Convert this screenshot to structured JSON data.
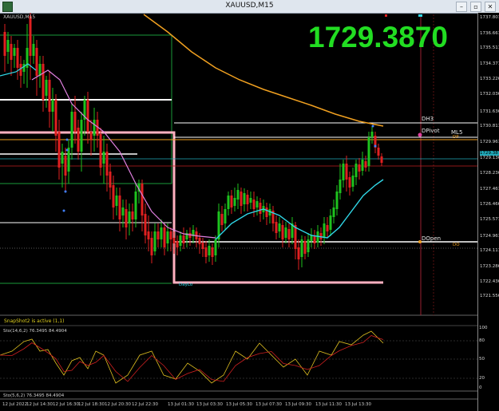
{
  "window": {
    "title": "XAUUSD,M15"
  },
  "symbol_label": "XAUUSD,M15",
  "price_display": "1729.3870",
  "price_axis": {
    "labels": [
      "1737.801",
      "1736.661",
      "1735.511",
      "1734.371",
      "1733.226",
      "1732.036",
      "1731.636",
      "1730.811",
      "1729.961",
      "1729.387",
      "1729.136",
      "1728.236",
      "1727.461",
      "1726.466",
      "1725.571",
      "1724.961",
      "1724.111",
      "1723.286",
      "1722.436",
      "1721.556"
    ]
  },
  "levels": {
    "dh3": "DH3",
    "dpivot": "DPivot",
    "ml5": "ML5",
    "dp": "DP",
    "dopen": "DOpen",
    "do": "DO",
    "daylo": "DayLo"
  },
  "snapshot_text": "SnapShot2 is active (1,1)",
  "stoch1": {
    "label": "Sto(14,6,2) 76.3495 84.4904",
    "axis": [
      "100",
      "80",
      "50",
      "20",
      "0"
    ]
  },
  "stoch2": {
    "label": "Sto(5,6,2) 76.3495 84.4904"
  },
  "time_axis": [
    "12 Jul 2022",
    "12 Jul 14:30",
    "12 Jul 16:30",
    "12 Jul 18:30",
    "12 Jul 20:30",
    "12 Jul 22:30",
    "13 Jul 01:30",
    "13 Jul 03:30",
    "13 Jul 05:30",
    "13 Jul 07:30",
    "13 Jul 09:30",
    "13 Jul 11:30",
    "13 Jul 13:30"
  ],
  "colors": {
    "bull": "#1ec21e",
    "bear": "#e02020",
    "ma_orange": "#f0a020",
    "ma_pink": "#e080e0",
    "ma_cyan": "#30d8e8",
    "price_big": "#22dd22",
    "snapshot": "#e0d020"
  }
}
